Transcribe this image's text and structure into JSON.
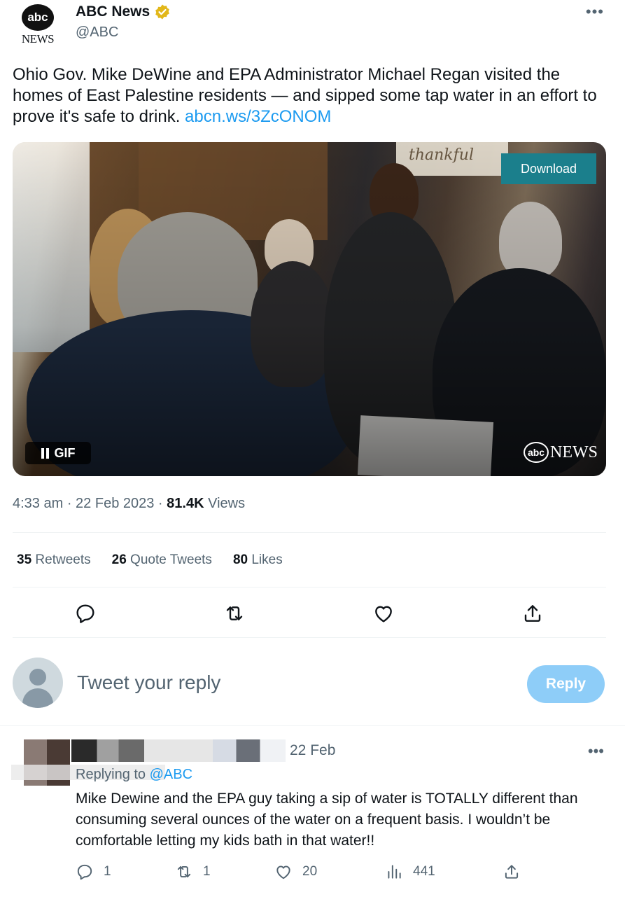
{
  "author": {
    "name": "ABC News",
    "handle": "@ABC",
    "logo_text_top": "abc",
    "logo_text_bottom": "NEWS"
  },
  "tweet": {
    "text_before_link": "Ohio Gov. Mike DeWine and EPA Administrator Michael Regan visited the homes of East Palestine residents — and sipped some tap water in an effort to prove it's safe to drink. ",
    "link": "abcn.ws/3ZcONOM",
    "media": {
      "download_label": "Download",
      "gif_label": "GIF",
      "watermark_logo": "abc",
      "watermark_text": "NEWS",
      "sign_text": "thankful"
    },
    "time": "4:33 am",
    "date": "22 Feb 2023",
    "views_count": "81.4K",
    "views_label": "Views"
  },
  "stats": {
    "retweets_count": "35",
    "retweets_label": "Retweets",
    "quotes_count": "26",
    "quotes_label": "Quote Tweets",
    "likes_count": "80",
    "likes_label": "Likes"
  },
  "compose": {
    "placeholder": "Tweet your reply",
    "reply_button": "Reply"
  },
  "reply": {
    "date": "22 Feb",
    "replying_prefix": "Replying to",
    "replying_handle": "@ABC",
    "text": "Mike Dewine and the EPA guy taking a sip of water is TOTALLY different than consuming several ounces of the water on a frequent basis. I wouldn’t be comfortable letting my kids bath in that water!!",
    "reply_count": "1",
    "retweet_count": "1",
    "like_count": "20",
    "view_count": "441"
  },
  "colors": {
    "link": "#1d9bf0",
    "secondary": "#536471",
    "reply_button": "#8ecdf8",
    "download_button": "#1b7f8c",
    "verified_badge": "#e2b719"
  }
}
